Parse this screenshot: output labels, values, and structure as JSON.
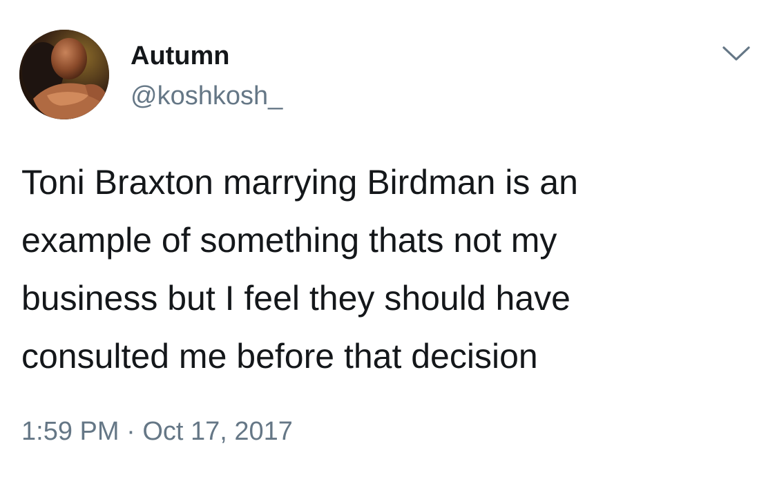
{
  "tweet": {
    "author": {
      "display_name": "Autumn",
      "handle": "@koshkosh_",
      "avatar_icon": "profile-photo"
    },
    "menu_icon": "chevron-down-icon",
    "text_lines": [
      "Toni Braxton marrying Birdman is an",
      "example of something thats not my",
      "business but I feel they should have",
      "consulted me before that decision"
    ],
    "time": "1:59 PM",
    "separator": "·",
    "date": "Oct 17, 2017"
  },
  "colors": {
    "text_primary": "#14171a",
    "text_secondary": "#657786",
    "background": "#ffffff"
  }
}
